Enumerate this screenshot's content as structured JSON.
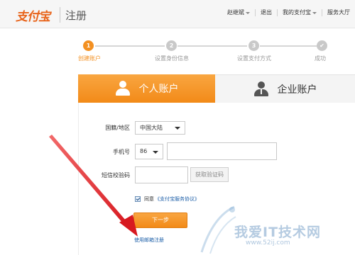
{
  "header": {
    "logo_text": "支付宝",
    "title": "注册",
    "nav": [
      {
        "label": "赵继斌",
        "has_caret": true
      },
      {
        "label": "退出",
        "has_caret": false
      },
      {
        "label": "我的支付宝",
        "has_caret": true
      },
      {
        "label": "服务大厅",
        "has_caret": false
      }
    ]
  },
  "progress": {
    "current_step": 1,
    "steps": [
      {
        "number": "1",
        "label": "创建账户"
      },
      {
        "number": "2",
        "label": "设置身份信息"
      },
      {
        "number": "3",
        "label": "设置支付方式"
      },
      {
        "number": "✔",
        "label": "成功"
      }
    ]
  },
  "tabs": {
    "personal": {
      "label": "个人账户",
      "icon": "person-icon",
      "active": true
    },
    "business": {
      "label": "企业账户",
      "icon": "business-person-icon",
      "active": false
    }
  },
  "form": {
    "region_label": "国籍/地区",
    "region_value": "中国大陆",
    "phone_label": "手机号",
    "country_code": "86",
    "phone_value": "",
    "sms_label": "短信校验码",
    "sms_value": "",
    "get_code_label": "获取验证码",
    "agree_text": "同意",
    "agree_link": "《支付宝服务协议》",
    "agree_checked": true,
    "next_label": "下一步",
    "email_link": "使用邮箱注册"
  },
  "colors": {
    "accent": "#f28a18",
    "link": "#1d5fa8",
    "annotation": "#e0242a"
  },
  "watermark": {
    "text": "我爱IT技术网",
    "url": "www.52ij.com"
  }
}
